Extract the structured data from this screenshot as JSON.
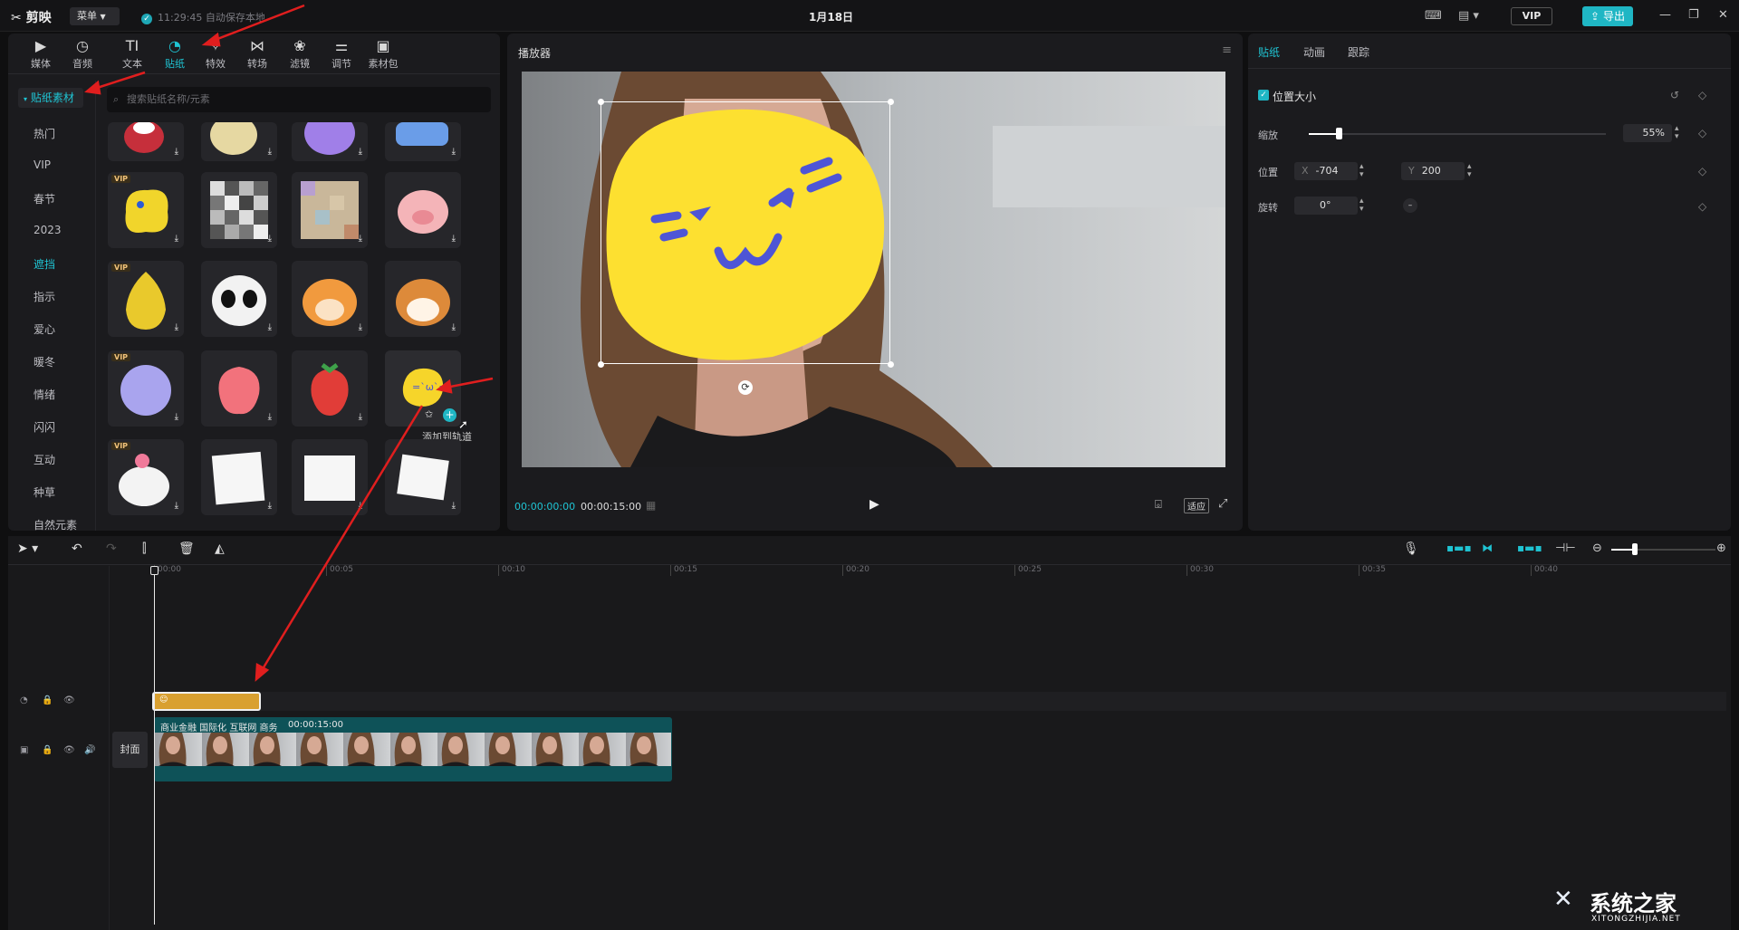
{
  "titlebar": {
    "app_name": "剪映",
    "menu_label": "菜单",
    "save_status": "11:29:45 自动保存本地",
    "project_date": "1月18日",
    "vip_label": "VIP",
    "export_label": "导出"
  },
  "toolbar": {
    "tools": [
      {
        "label": "媒体",
        "icon": "media-icon"
      },
      {
        "label": "音频",
        "icon": "audio-icon"
      },
      {
        "label": "文本",
        "icon": "text-icon"
      },
      {
        "label": "贴纸",
        "icon": "sticker-icon",
        "active": true
      },
      {
        "label": "特效",
        "icon": "effects-icon"
      },
      {
        "label": "转场",
        "icon": "transition-icon"
      },
      {
        "label": "滤镜",
        "icon": "filter-icon"
      },
      {
        "label": "调节",
        "icon": "adjust-icon"
      },
      {
        "label": "素材包",
        "icon": "package-icon"
      }
    ]
  },
  "library": {
    "section_title": "贴纸素材",
    "search_placeholder": "搜索贴纸名称/元素",
    "categories": [
      "热门",
      "VIP",
      "春节",
      "2023",
      "遮挡",
      "指示",
      "爱心",
      "暖冬",
      "情绪",
      "闪闪",
      "互动",
      "种草",
      "自然元素"
    ],
    "active_category": "遮挡",
    "vip_badge": "VIP",
    "add_tooltip": "添加到轨道"
  },
  "player": {
    "title": "播放器",
    "current_time": "00:00:00:00",
    "total_time": "00:00:15:00",
    "fit_label": "适应"
  },
  "properties": {
    "tabs": [
      "贴纸",
      "动画",
      "跟踪"
    ],
    "active_tab": "贴纸",
    "section": "位置大小",
    "scale_label": "缩放",
    "scale_value": "55%",
    "scale_fraction": 0.55,
    "position_label": "位置",
    "x_label": "X",
    "x_value": "-704",
    "y_label": "Y",
    "y_value": "200",
    "rotation_label": "旋转",
    "rotation_value": "0°"
  },
  "timeline": {
    "timecodes": [
      "00:00",
      "00:05",
      "00:10",
      "00:15",
      "00:20",
      "00:25",
      "00:30",
      "00:35",
      "00:40"
    ],
    "cover_label": "封面",
    "clip_tags": "商业金融 国际化 互联网 商务",
    "clip_duration": "00:00:15:00"
  },
  "watermark": {
    "text": "系统之家",
    "url": "XITONGZHIJIA.NET"
  },
  "colors": {
    "accent": "#1fc4d3",
    "sticker_clip": "#d9a030",
    "video_clip": "#0e5258",
    "background": "#0f0f10",
    "panel": "#1b1b1e"
  }
}
